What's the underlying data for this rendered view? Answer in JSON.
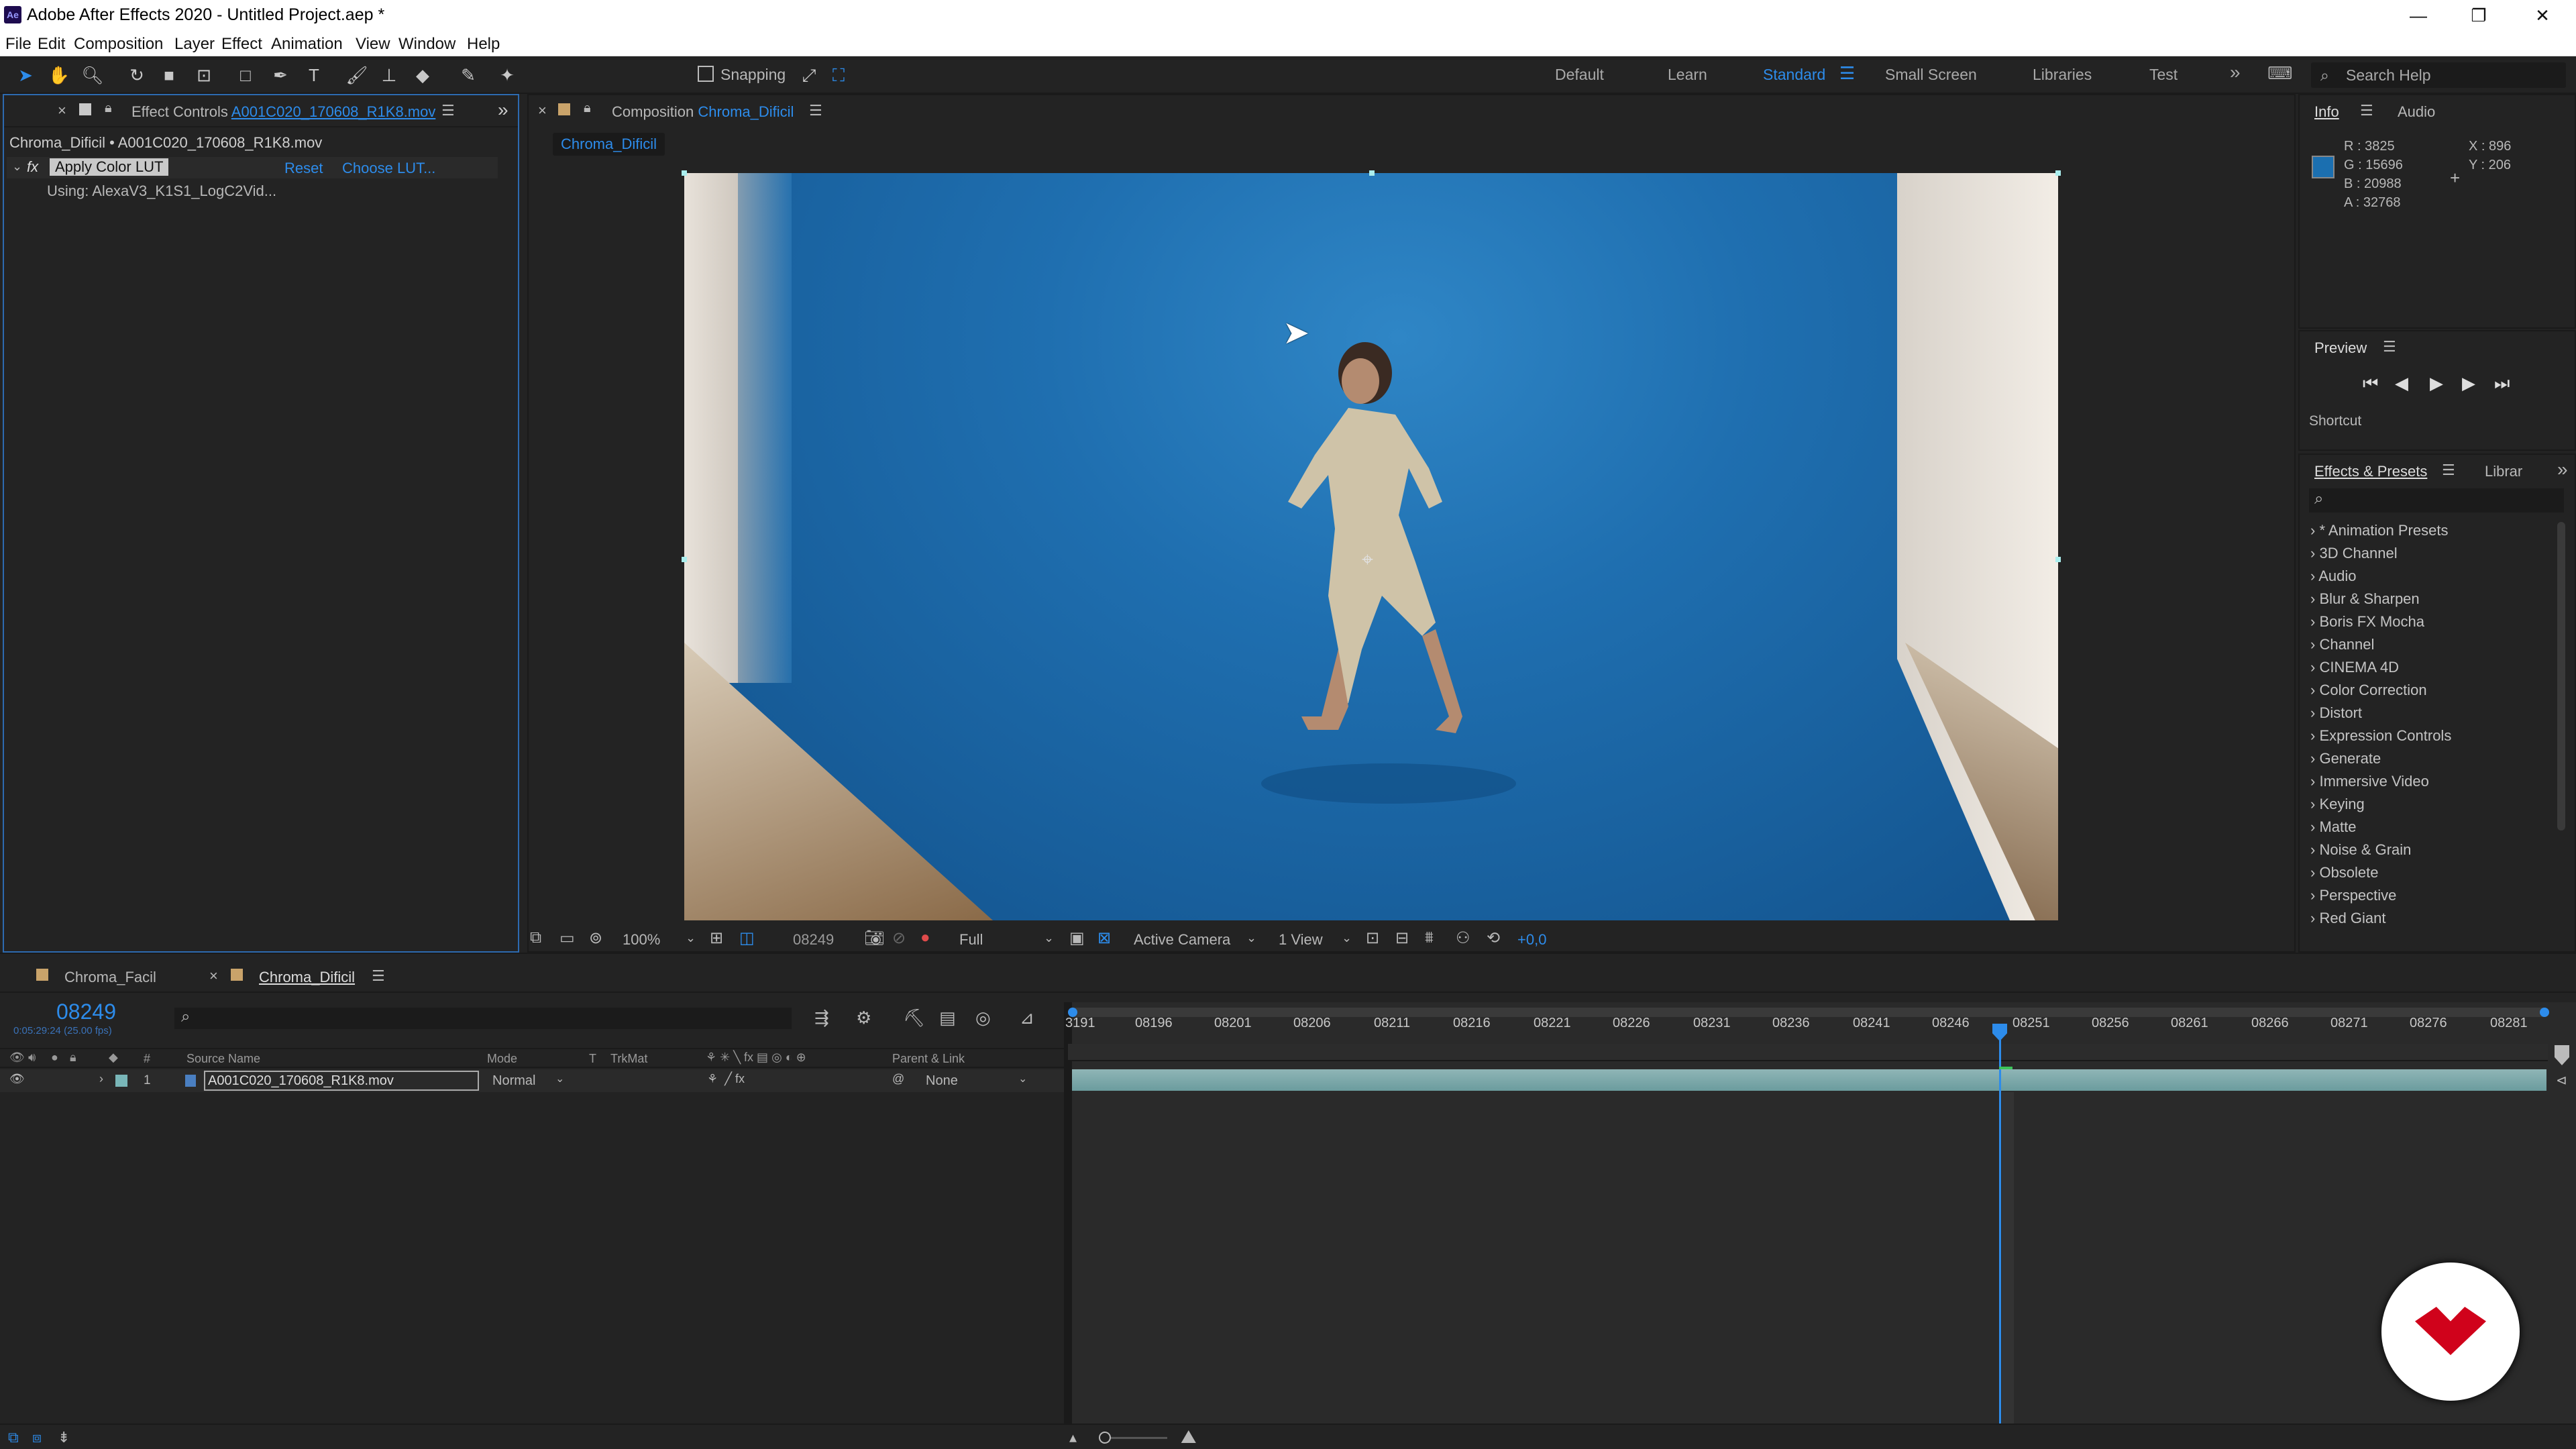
{
  "app": {
    "icon": "Ae",
    "title": "Adobe After Effects 2020 - Untitled Project.aep *"
  },
  "window_controls": {
    "minimize": "—",
    "restore": "❐",
    "close": "✕"
  },
  "menu": [
    "File",
    "Edit",
    "Composition",
    "Layer",
    "Effect",
    "Animation",
    "View",
    "Window",
    "Help"
  ],
  "toolbar": {
    "snapping_label": "Snapping",
    "workspaces": [
      "Default",
      "Learn",
      "Standard",
      "Small Screen",
      "Libraries",
      "Test"
    ],
    "active_workspace": "Standard",
    "search_placeholder": "Search Help"
  },
  "effect_controls": {
    "tab_prefix": "Effect Controls",
    "tab_file": "A001C020_170608_R1K8.mov",
    "path": "Chroma_Dificil • A001C020_170608_R1K8.mov",
    "effect_name": "Apply Color LUT",
    "reset_label": "Reset",
    "choose_label": "Choose LUT...",
    "using_text": "Using: AlexaV3_K1S1_LogC2Vid..."
  },
  "composition": {
    "tab_prefix": "Composition",
    "tab_name": "Chroma_Dificil",
    "sub_tab": "Chroma_Dificil",
    "zoom": "100%",
    "timecode": "08249",
    "resolution": "Full",
    "camera": "Active Camera",
    "views": "1 View",
    "exposure": "+0,0"
  },
  "info": {
    "tab_info": "Info",
    "tab_audio": "Audio",
    "r": "R : 3825",
    "g": "G : 15696",
    "b": "B : 20988",
    "a": "A : 32768",
    "x": "X : 896",
    "y": "Y : 206",
    "swatch_color": "#1b6fb0"
  },
  "preview": {
    "title": "Preview",
    "shortcut_label": "Shortcut"
  },
  "effects_presets": {
    "tab": "Effects & Presets",
    "tab2": "Librar",
    "items": [
      "* Animation Presets",
      "3D Channel",
      "Audio",
      "Blur & Sharpen",
      "Boris FX Mocha",
      "Channel",
      "CINEMA 4D",
      "Color Correction",
      "Distort",
      "Expression Controls",
      "Generate",
      "Immersive Video",
      "Keying",
      "Matte",
      "Noise & Grain",
      "Obsolete",
      "Perspective",
      "Red Giant"
    ]
  },
  "timeline": {
    "tabs": [
      "Chroma_Facil",
      "Chroma_Dificil"
    ],
    "active_tab": "Chroma_Dificil",
    "timecode": "08249",
    "sub_timecode": "0:05:29:24 (25.00 fps)",
    "headers": {
      "num": "#",
      "source": "Source Name",
      "mode": "Mode",
      "t": "T",
      "trkmat": "TrkMat",
      "parent": "Parent & Link"
    },
    "layer": {
      "index": "1",
      "name": "A001C020_170608_R1K8.mov",
      "mode": "Normal",
      "parent": "None"
    },
    "ruler": [
      "3191",
      "08196",
      "08201",
      "08206",
      "08211",
      "08216",
      "08221",
      "08226",
      "08231",
      "08236",
      "08241",
      "08246",
      "08251",
      "08256",
      "08261",
      "08266",
      "08271",
      "08276",
      "08281"
    ]
  },
  "accent_colors": {
    "blue": "#2d8ceb",
    "logo_red": "#d0021b"
  }
}
